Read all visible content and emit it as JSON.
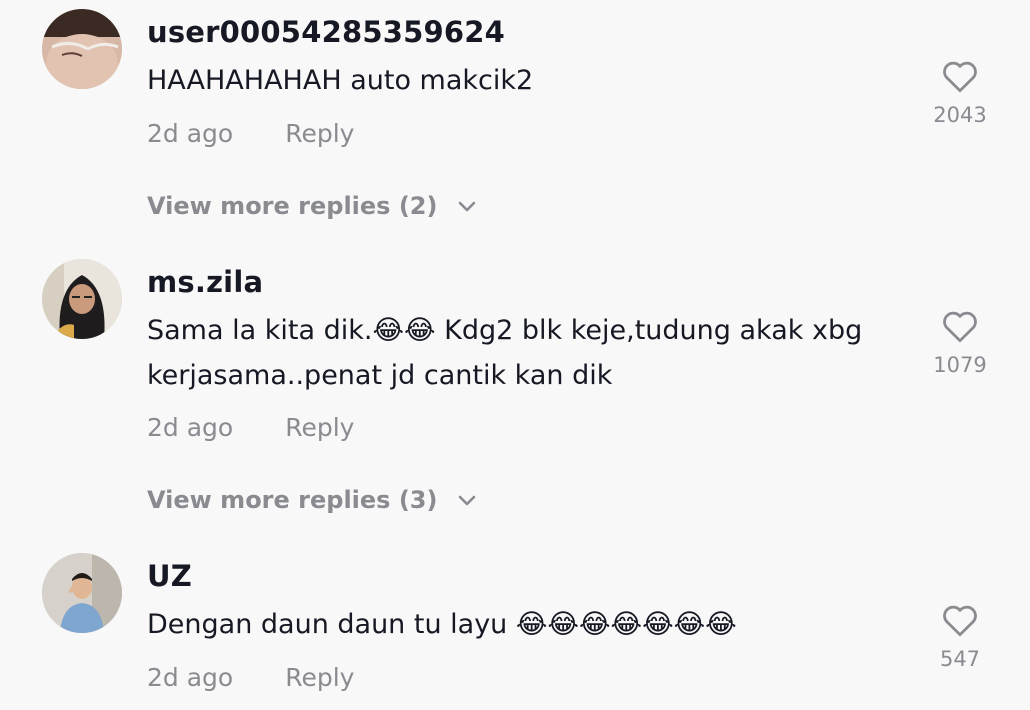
{
  "comments": [
    {
      "username": "user00054285359624",
      "text": "HAAHAHAHAH auto makcik2",
      "time": "2d ago",
      "reply_label": "Reply",
      "likes": "2043",
      "view_more": "View more replies (2)",
      "avatar_icon": "avatar-face-glasses"
    },
    {
      "username": "ms.zila",
      "text": "Sama la kita dik.😂😂 Kdg2 blk keje,tudung akak xbg kerjasama..penat jd cantik kan dik",
      "time": "2d ago",
      "reply_label": "Reply",
      "likes": "1079",
      "view_more": "View more replies (3)",
      "avatar_icon": "avatar-woman-hijab"
    },
    {
      "username": "UZ",
      "text": "Dengan daun daun tu layu 😂😂😂😂😂😂😂",
      "time": "2d ago",
      "reply_label": "Reply",
      "likes": "547",
      "avatar_icon": "avatar-man-shirt"
    }
  ],
  "colors": {
    "background": "#f8f8f8",
    "primary_text": "#161823",
    "secondary_text": "#8a8b91"
  }
}
